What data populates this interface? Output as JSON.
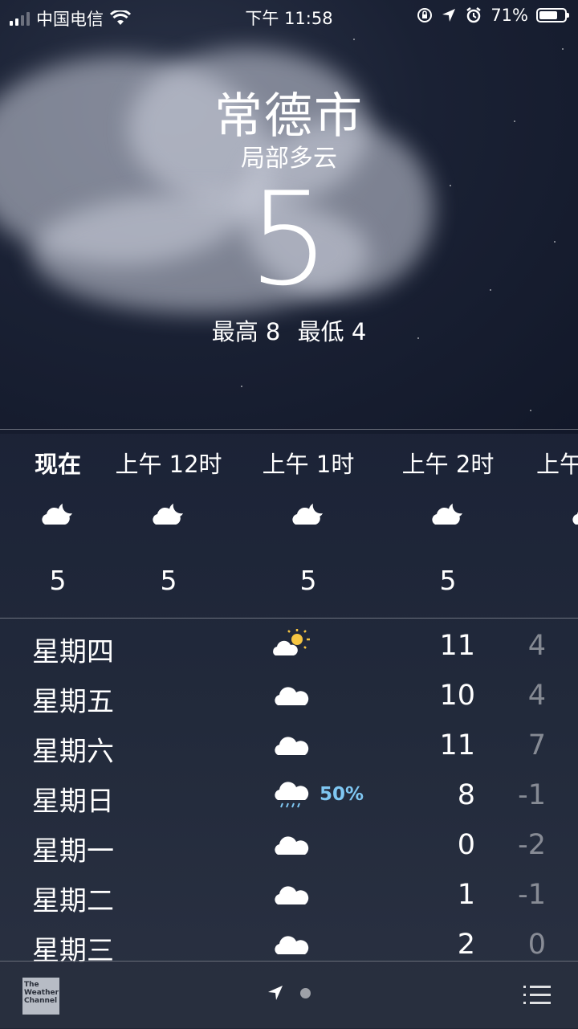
{
  "status_bar": {
    "carrier": "中国电信",
    "time": "下午 11:58",
    "battery": "71%"
  },
  "header": {
    "city": "常德市",
    "condition": "局部多云",
    "temperature": "5",
    "high": "最高 8",
    "low": "最低 4"
  },
  "hourly": [
    {
      "label": "现在",
      "icon": "partly-cloudy-night-icon",
      "temp": "5"
    },
    {
      "label": "上午 12时",
      "icon": "partly-cloudy-night-icon",
      "temp": "5"
    },
    {
      "label": "上午 1时",
      "icon": "partly-cloudy-night-icon",
      "temp": "5"
    },
    {
      "label": "上午 2时",
      "icon": "partly-cloudy-night-icon",
      "temp": "5"
    },
    {
      "label": "上午",
      "icon": "partly-cloudy-night-icon",
      "temp": ""
    }
  ],
  "daily": [
    {
      "day": "星期四",
      "icon": "partly-sunny-icon",
      "pop": "",
      "high": "11",
      "low": "4"
    },
    {
      "day": "星期五",
      "icon": "cloud-icon",
      "pop": "",
      "high": "10",
      "low": "4"
    },
    {
      "day": "星期六",
      "icon": "cloud-icon",
      "pop": "",
      "high": "11",
      "low": "7"
    },
    {
      "day": "星期日",
      "icon": "rain-icon",
      "pop": "50%",
      "high": "8",
      "low": "-1"
    },
    {
      "day": "星期一",
      "icon": "cloud-icon",
      "pop": "",
      "high": "0",
      "low": "-2"
    },
    {
      "day": "星期二",
      "icon": "cloud-icon",
      "pop": "",
      "high": "1",
      "low": "-1"
    },
    {
      "day": "星期三",
      "icon": "cloud-icon",
      "pop": "",
      "high": "2",
      "low": "0"
    }
  ],
  "bottom_bar": {
    "logo_text": "The Weather Channel"
  },
  "colors": {
    "precipitation": "#7fc7f2",
    "low_temp": "rgba(255,255,255,0.45)"
  }
}
